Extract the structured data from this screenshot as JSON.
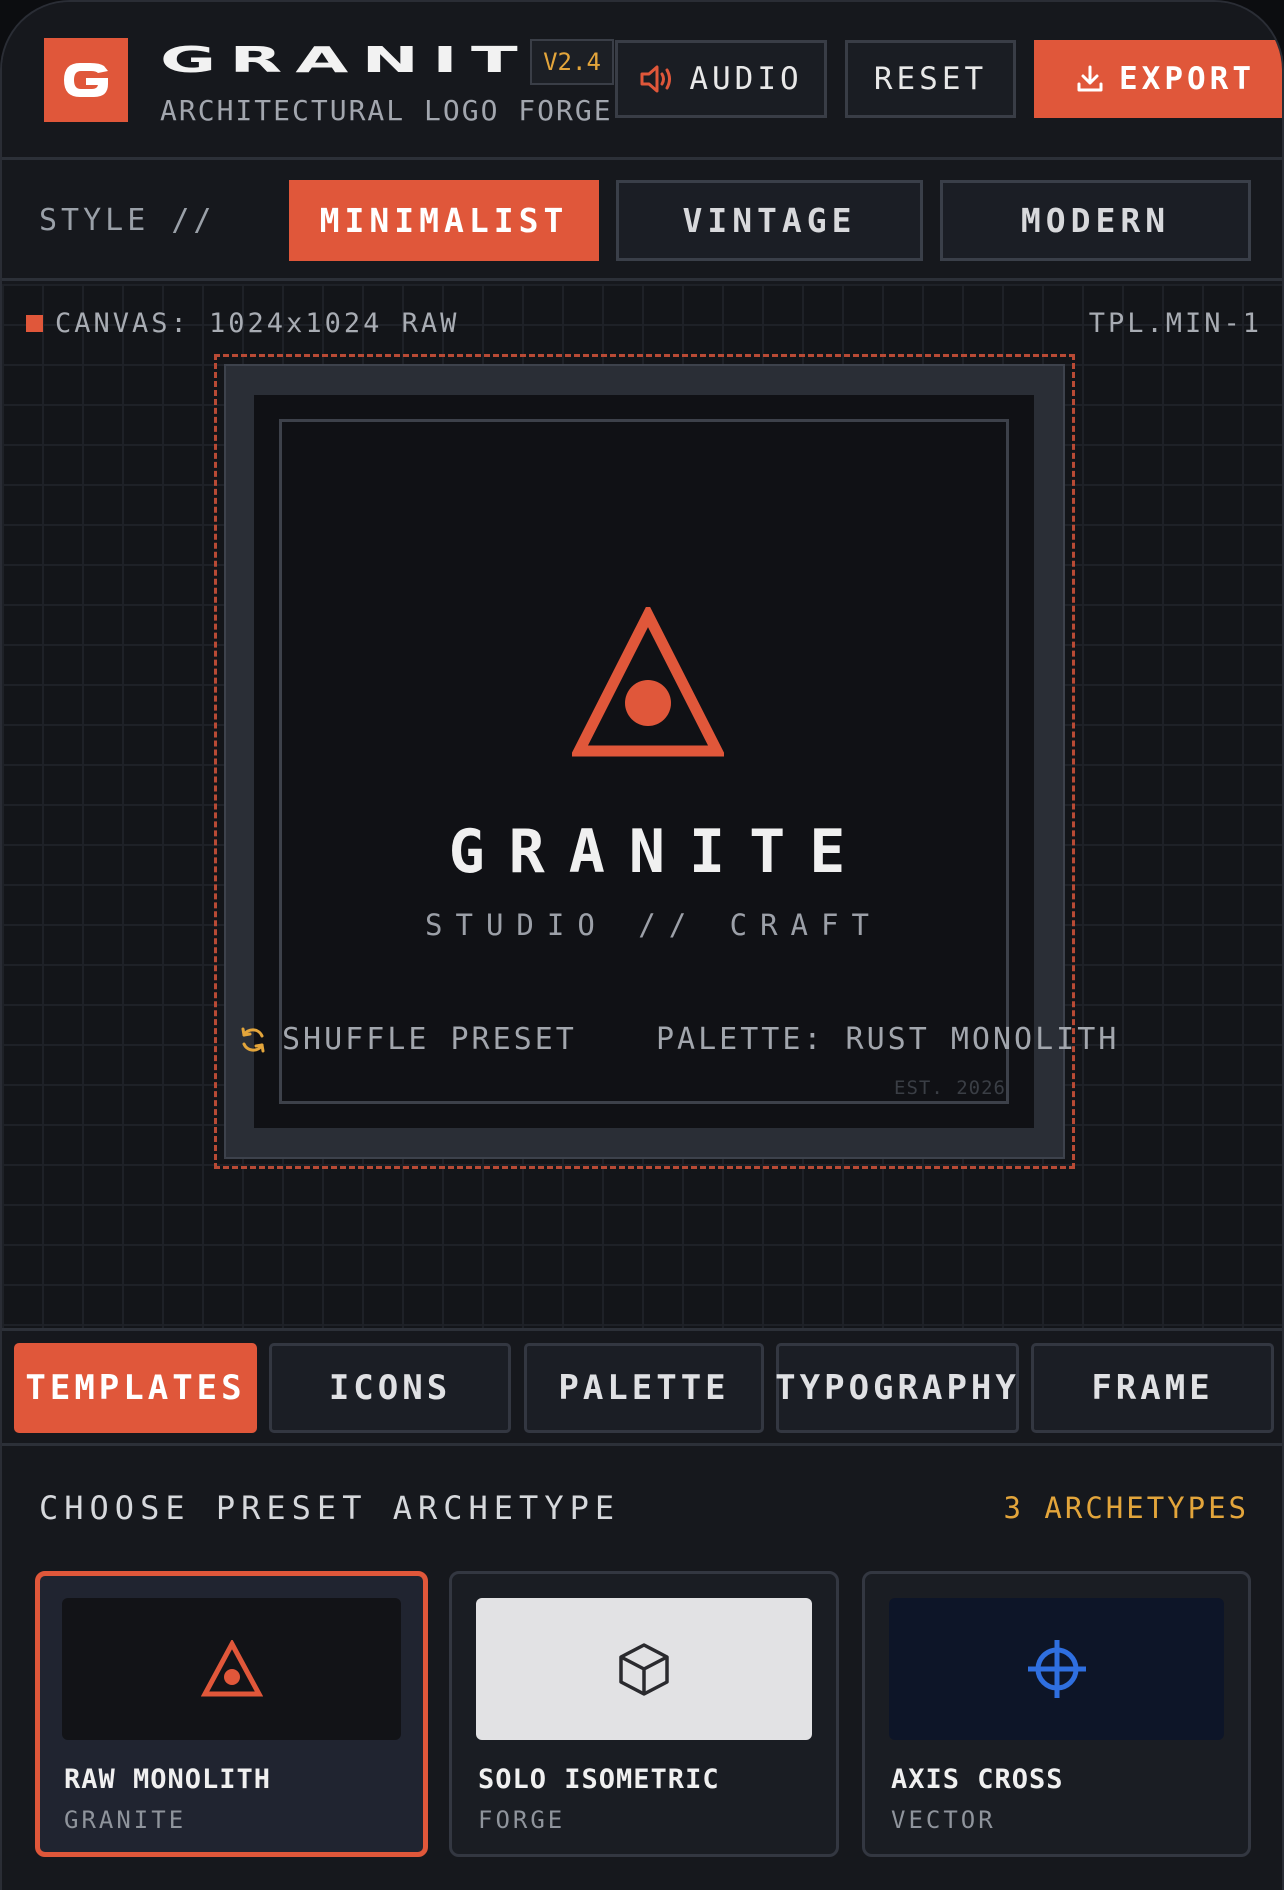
{
  "header": {
    "logo_letter": "G",
    "brand": "GRANITE",
    "version": "V2.4",
    "subtitle": "ARCHITECTURAL LOGO FORGE",
    "audio_label": "AUDIO",
    "reset_label": "RESET",
    "export_label": "EXPORT"
  },
  "style": {
    "label": "STYLE //",
    "options": [
      "MINIMALIST",
      "VINTAGE",
      "MODERN"
    ],
    "selected": "MINIMALIST"
  },
  "canvas": {
    "info": "CANVAS: 1024x1024 RAW",
    "template_id": "TPL.MIN-1",
    "logo_title": "GRANITE",
    "logo_subtitle": "STUDIO // CRAFT",
    "est": "EST. 2026",
    "shuffle_label": "SHUFFLE PRESET",
    "palette_label": "PALETTE: RUST MONOLITH"
  },
  "tabs": {
    "items": [
      "TEMPLATES",
      "ICONS",
      "PALETTE",
      "TYPOGRAPHY",
      "FRAME"
    ],
    "selected": "TEMPLATES"
  },
  "presets": {
    "title": "CHOOSE PRESET ARCHETYPE",
    "count": "3 ARCHETYPES",
    "cards": [
      {
        "title": "RAW MONOLITH",
        "sub": "GRANITE",
        "icon": "triangle-eye-icon",
        "selected": true
      },
      {
        "title": "SOLO ISOMETRIC",
        "sub": "FORGE",
        "icon": "cube-icon",
        "selected": false
      },
      {
        "title": "AXIS CROSS",
        "sub": "VECTOR",
        "icon": "crosshair-icon",
        "selected": false
      }
    ]
  },
  "colors": {
    "accent": "#e0573a",
    "gold": "#e3a53b",
    "blue": "#2f6fe0",
    "background": "#16181d"
  }
}
